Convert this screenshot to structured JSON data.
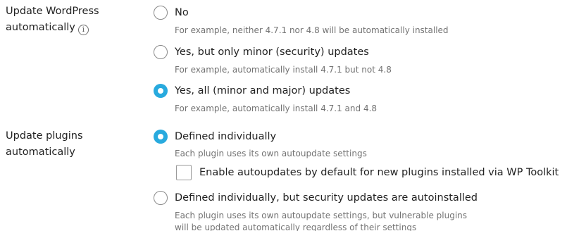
{
  "wordpress_updates": {
    "label_line1": "Update WordPress",
    "label_line2": "automatically",
    "info_icon": "i",
    "options": [
      {
        "label": "No",
        "hint": "For example, neither 4.7.1 nor 4.8 will be automatically installed",
        "checked": false
      },
      {
        "label": "Yes, but only minor (security) updates",
        "hint": "For example, automatically install 4.7.1 but not 4.8",
        "checked": false
      },
      {
        "label": "Yes, all (minor and major) updates",
        "hint": "For example, automatically install 4.7.1 and 4.8",
        "checked": true
      }
    ]
  },
  "plugin_updates": {
    "label_line1": "Update plugins",
    "label_line2": "automatically",
    "options": [
      {
        "label": "Defined individually",
        "hint": "Each plugin uses its own autoupdate settings",
        "checked": true
      },
      {
        "label": "Defined individually, but security updates are autoinstalled",
        "hint_line1": "Each plugin uses its own autoupdate settings, but vulnerable plugins",
        "hint_line2": "will be updated automatically regardless of their settings",
        "checked": false
      }
    ],
    "checkbox": {
      "label": "Enable autoupdates by default for new plugins installed via WP Toolkit",
      "checked": false
    }
  },
  "colors": {
    "accent": "#28aade",
    "text": "#222222",
    "hint": "#737373"
  },
  "icons": {
    "info": "info-icon",
    "radio": "radio-button",
    "checkbox": "checkbox"
  }
}
